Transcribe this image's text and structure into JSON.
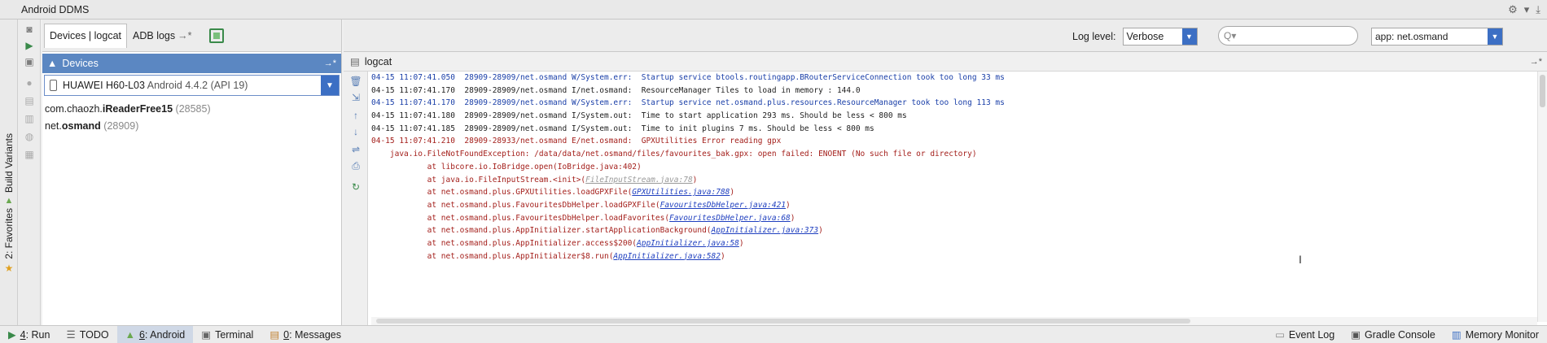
{
  "window": {
    "title": "Android DDMS"
  },
  "side_tabs": {
    "build_variants": "Build Variants",
    "favorites": "2: Favorites"
  },
  "devices_panel": {
    "tab_devices": "Devices | logcat",
    "tab_adb": "ADB logs",
    "header": "Devices",
    "device_name": "HUAWEI H60-L03",
    "device_version": "Android 4.4.2 (API 19)",
    "processes": [
      {
        "prefix": "com.chaozh.",
        "bold": "iReaderFree15",
        "pid": "(28585)"
      },
      {
        "prefix": "net.",
        "bold": "osmand",
        "pid": "(28909)"
      }
    ]
  },
  "logcat": {
    "header": "logcat",
    "log_level_label": "Log level:",
    "log_level_value": "Verbose",
    "search_placeholder": "Q▾",
    "app_filter": "app: net.osmand",
    "lines": [
      {
        "cls": "c-warn",
        "text": "04-15 11:07:41.050  28909-28909/net.osmand W/System.err:  Startup service btools.routingapp.BRouterServiceConnection took too long 33 ms"
      },
      {
        "cls": "c-info",
        "text": "04-15 11:07:41.170  28909-28909/net.osmand I/net.osmand:  ResourceManager Tiles to load in memory : 144.0"
      },
      {
        "cls": "c-warn",
        "text": "04-15 11:07:41.170  28909-28909/net.osmand W/System.err:  Startup service net.osmand.plus.resources.ResourceManager took too long 113 ms"
      },
      {
        "cls": "c-info",
        "text": "04-15 11:07:41.180  28909-28909/net.osmand I/System.out:  Time to start application 293 ms. Should be less < 800 ms"
      },
      {
        "cls": "c-info",
        "text": "04-15 11:07:41.185  28909-28909/net.osmand I/System.out:  Time to init plugins 7 ms. Should be less < 800 ms"
      },
      {
        "cls": "c-err",
        "text": "04-15 11:07:41.210  28909-28933/net.osmand E/net.osmand:  GPXUtilities Error reading gpx"
      },
      {
        "cls": "c-err",
        "text": "    java.io.FileNotFoundException: /data/data/net.osmand/files/favourites_bak.gpx: open failed: ENOENT (No such file or directory)"
      },
      {
        "cls": "c-err",
        "text": "            at libcore.io.IoBridge.open(IoBridge.java:402)"
      },
      {
        "cls": "c-err",
        "text": "            at java.io.FileInputStream.<init>(",
        "link": "FileInputStream.java:78",
        "linkcls": "gray",
        "tail": ")"
      },
      {
        "cls": "c-err",
        "text": "            at net.osmand.plus.GPXUtilities.loadGPXFile(",
        "link": "GPXUtilities.java:788",
        "linkcls": "blue",
        "tail": ")"
      },
      {
        "cls": "c-err",
        "text": "            at net.osmand.plus.FavouritesDbHelper.loadGPXFile(",
        "link": "FavouritesDbHelper.java:421",
        "linkcls": "blue",
        "tail": ")"
      },
      {
        "cls": "c-err",
        "text": "            at net.osmand.plus.FavouritesDbHelper.loadFavorites(",
        "link": "FavouritesDbHelper.java:68",
        "linkcls": "blue",
        "tail": ")"
      },
      {
        "cls": "c-err",
        "text": "            at net.osmand.plus.AppInitializer.startApplicationBackground(",
        "link": "AppInitializer.java:373",
        "linkcls": "blue",
        "tail": ")"
      },
      {
        "cls": "c-err",
        "text": "            at net.osmand.plus.AppInitializer.access$200(",
        "link": "AppInitializer.java:58",
        "linkcls": "blue",
        "tail": ")"
      },
      {
        "cls": "c-err",
        "text": "            at net.osmand.plus.AppInitializer$8.run(",
        "link": "AppInitializer.java:582",
        "linkcls": "blue",
        "tail": ")"
      }
    ]
  },
  "statusbar": {
    "run": {
      "u": "4",
      "rest": ": Run"
    },
    "todo": "TODO",
    "android": {
      "u": "6",
      "rest": ": Android"
    },
    "terminal": "Terminal",
    "messages": {
      "u": "0",
      "rest": ": Messages"
    },
    "event_log": "Event Log",
    "gradle_console": "Gradle Console",
    "memory_monitor": "Memory Monitor"
  },
  "colors": {
    "accent": "#3c6fc4",
    "selected_header": "#5b87c2",
    "error": "#a4201c",
    "warn": "#1a3fa8"
  }
}
